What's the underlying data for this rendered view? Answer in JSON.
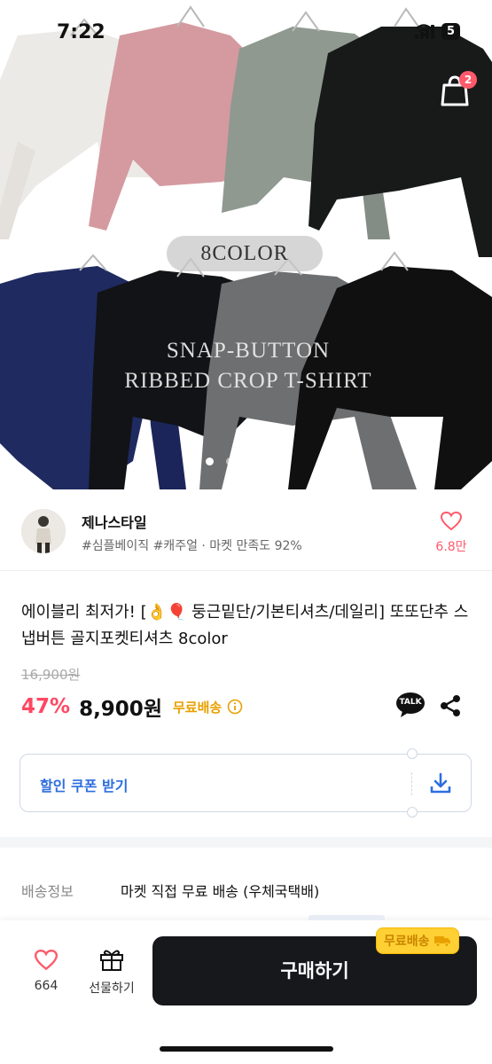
{
  "status_bar": {
    "time": "7:22",
    "network": "5G",
    "battery": "5"
  },
  "hero": {
    "color_count": "8COLOR",
    "overlay_line1": "SNAP-BUTTON",
    "overlay_line2": "RIBBED CROP T-SHIRT",
    "slides_total": 4,
    "active_slide": 1,
    "shirt_colors": [
      "#eceae6",
      "#d49aa0",
      "#8f9990",
      "#181a1a",
      "#1f2a60",
      "#121316",
      "#6e6f71",
      "#101010"
    ]
  },
  "nav": {
    "cart_count": "2"
  },
  "store": {
    "name": "제나스타일",
    "tags": "#심플베이직 #캐주얼 · 마켓 만족도 92%",
    "like_count": "6.8만"
  },
  "product": {
    "title": "에이블리 최저가! [👌🎈 둥근밑단/기본티셔츠/데일리] 또또단추 스냅버튼 골지포켓티셔츠 8color",
    "original_price": "16,900원",
    "discount": "47%",
    "price": "8,900원",
    "free_shipping": "무료배송",
    "talk_label": "TALK"
  },
  "coupon": {
    "label": "할인 쿠폰 받기"
  },
  "shipping": {
    "label": "배송정보",
    "value": "마켓 직접 무료 배송 (우체국택배)"
  },
  "bottom_bar": {
    "like_count": "664",
    "gift_label": "선물하기",
    "buy_label": "구매하기",
    "free_ship_badge": "무료배송"
  },
  "colors": {
    "accent_pink": "#ff4763",
    "coupon_blue": "#2d6ee0",
    "free_ship_orange": "#e8a000",
    "buy_dark": "#17181c"
  }
}
